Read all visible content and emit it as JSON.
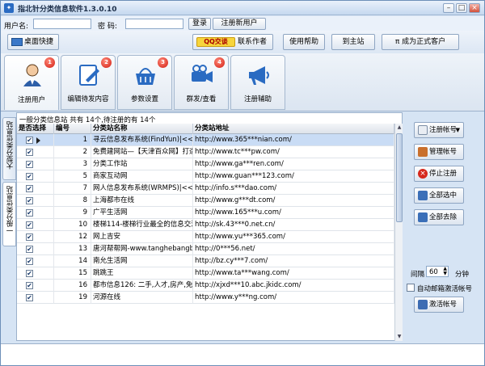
{
  "window": {
    "title": "指北针分类信息软件1.3.0.10",
    "controls": {
      "minimize": "–",
      "maximize": "□",
      "close": "×"
    }
  },
  "login": {
    "username_label": "用户名:",
    "username_value": "",
    "password_label": "密  码:",
    "password_value": "",
    "login_button": "登录",
    "register_button": "注册新用户"
  },
  "toolbar": {
    "desktop_shortcut": "桌面快捷",
    "qq_badge": "QQ交谈",
    "contact_author": "联系作者",
    "help": "使用帮助",
    "to_site": "到主站",
    "upgrade": "π 成为正式客户"
  },
  "tabs": [
    {
      "label": "注册用户",
      "badge": "1",
      "icon": "user-icon"
    },
    {
      "label": "编辑待发内容",
      "badge": "2",
      "icon": "edit-icon"
    },
    {
      "label": "参数设置",
      "badge": "3",
      "icon": "settings-basket-icon"
    },
    {
      "label": "群发/查看",
      "badge": "4",
      "icon": "projector-icon"
    },
    {
      "label": "注册辅助",
      "badge": "",
      "icon": "megaphone-icon"
    }
  ],
  "side_tabs": [
    "大型分类信息站",
    "一般分类信息站"
  ],
  "panel": {
    "caption": "一般分类信息站 共有 14个,待注册的有 14个",
    "columns": [
      "是否选择",
      "编号",
      "分类站名称",
      "分类站地址"
    ],
    "rows": [
      {
        "checked": true,
        "num": "1",
        "name": "寻云信息发布系统(FindYun)|<<最专",
        "url": "http://www.365***nian.com/",
        "selected": true
      },
      {
        "checked": true,
        "num": "2",
        "name": "免费建网站—【天津百众网】打造",
        "url": "http://www.tc***pw.com/"
      },
      {
        "checked": true,
        "num": "3",
        "name": "分类工作站",
        "url": "http://www.ga***ren.com/"
      },
      {
        "checked": true,
        "num": "5",
        "name": "商家互动网",
        "url": "http://www.guan***123.com/"
      },
      {
        "checked": true,
        "num": "7",
        "name": "网人信息发布系统(WRMPS)|<<最专",
        "url": "http://info.s***dao.com/"
      },
      {
        "checked": true,
        "num": "8",
        "name": "上海都市在线",
        "url": "http://www.g***dt.com/"
      },
      {
        "checked": true,
        "num": "9",
        "name": "广平生活网",
        "url": "http://www.165***u.com/"
      },
      {
        "checked": true,
        "num": "10",
        "name": "楼梯114-楼梯行业最全的信息交流",
        "url": "http://sk.43***0.net.cn/"
      },
      {
        "checked": true,
        "num": "12",
        "name": "网上吉安",
        "url": "http://www.yu***365.com/"
      },
      {
        "checked": true,
        "num": "13",
        "name": "唐河帮帮网-www.tanghebangbang",
        "url": "http://0***56.net/"
      },
      {
        "checked": true,
        "num": "14",
        "name": "南允生活网",
        "url": "http://bz.cy***7.com/"
      },
      {
        "checked": true,
        "num": "15",
        "name": "跳跳王",
        "url": "http://www.ta***wang.com/"
      },
      {
        "checked": true,
        "num": "16",
        "name": "都市信息126: 二手,人才,房产,免费",
        "url": "http://xjxd***10.abc.jkidc.com/"
      },
      {
        "checked": true,
        "num": "19",
        "name": "河源在线",
        "url": "http://www.y***ng.com/"
      }
    ]
  },
  "side_buttons": {
    "register_account": "注册帐号",
    "manage_account": "管理帐号",
    "stop_register": "停止注册",
    "select_all": "全部选中",
    "deselect_all": "全部去除",
    "interval_label": "间隔",
    "interval_value": "60",
    "interval_unit": "分钟",
    "auto_activate": "自动邮箱激活帐号",
    "activate_account": "激活帐号"
  },
  "colors": {
    "accent": "#2a6bc2",
    "badge": "#d21b10",
    "selected_row": "#c9dcf5"
  }
}
